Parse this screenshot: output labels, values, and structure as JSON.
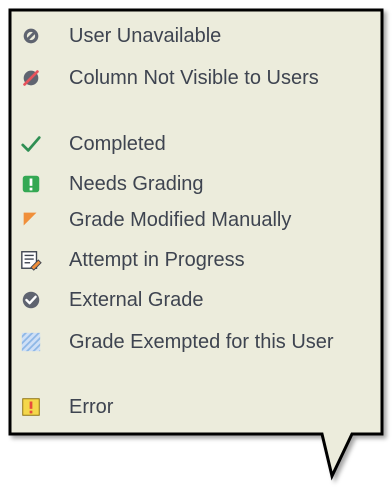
{
  "colors": {
    "background": "#ececdc",
    "border": "#000000",
    "text": "#3e4450",
    "check": "#2f8f53",
    "green": "#34a853",
    "orange": "#f08f3a",
    "red": "#e74c3c",
    "blue": "#8fb8e6"
  },
  "legend": {
    "items": [
      {
        "icon": "user-unavailable-icon",
        "label": "User Unavailable"
      },
      {
        "icon": "column-not-visible-icon",
        "label": "Column Not Visible to Users"
      },
      {
        "icon": "completed-check-icon",
        "label": "Completed"
      },
      {
        "icon": "needs-grading-icon",
        "label": "Needs Grading"
      },
      {
        "icon": "grade-modified-manually-icon",
        "label": "Grade Modified Manually"
      },
      {
        "icon": "attempt-in-progress-icon",
        "label": "Attempt in Progress"
      },
      {
        "icon": "external-grade-icon",
        "label": "External Grade"
      },
      {
        "icon": "grade-exempted-icon",
        "label": "Grade Exempted for this User"
      },
      {
        "icon": "error-icon",
        "label": "Error"
      }
    ]
  }
}
